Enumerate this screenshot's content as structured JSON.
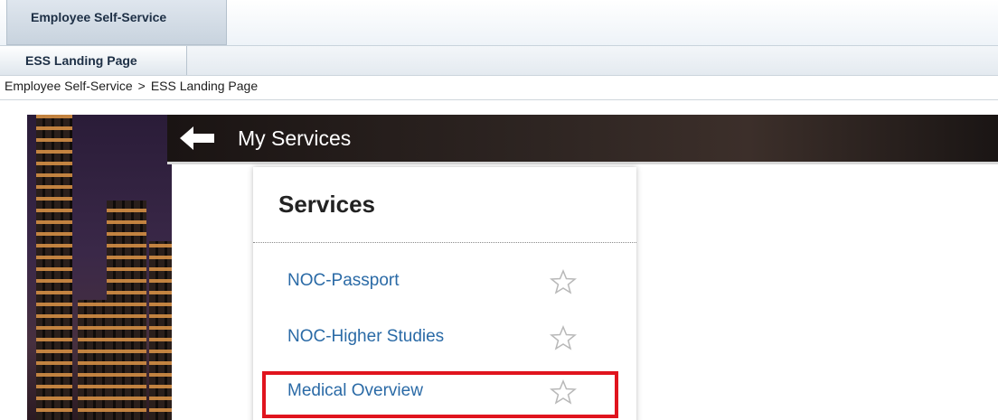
{
  "app": {
    "top_tab": "Employee Self-Service",
    "sub_tab": "ESS Landing Page"
  },
  "breadcrumb": {
    "items": [
      "Employee Self-Service",
      "ESS Landing Page"
    ],
    "separator": ">"
  },
  "header": {
    "back_icon": "back-arrow-icon",
    "title": "My Services"
  },
  "services": {
    "title": "Services",
    "items": [
      {
        "label": "NOC-Passport",
        "favorite_icon": "star-outline-icon",
        "highlighted": false
      },
      {
        "label": "NOC-Higher Studies",
        "favorite_icon": "star-outline-icon",
        "highlighted": false
      },
      {
        "label": "Medical Overview",
        "favorite_icon": "star-outline-icon",
        "highlighted": true
      }
    ]
  },
  "colors": {
    "link": "#2a6aa6",
    "highlight_border": "#e0141e",
    "header_text": "#ffffff"
  }
}
